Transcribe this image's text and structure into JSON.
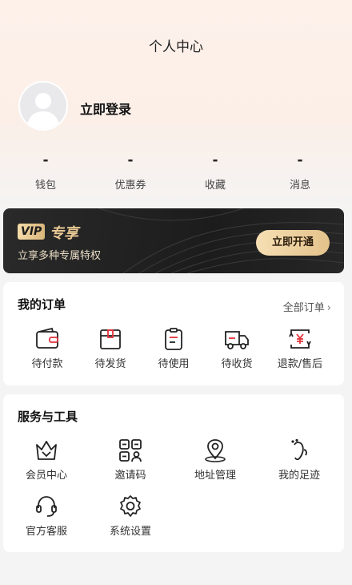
{
  "header": {
    "title": "个人中心"
  },
  "profile": {
    "login_label": "立即登录"
  },
  "stats": [
    {
      "value": "-",
      "label": "钱包"
    },
    {
      "value": "-",
      "label": "优惠券"
    },
    {
      "value": "-",
      "label": "收藏"
    },
    {
      "value": "-",
      "label": "消息"
    }
  ],
  "vip": {
    "badge": "VIP",
    "title": "专享",
    "subtitle": "立享多种专属特权",
    "button": "立即开通"
  },
  "orders": {
    "title": "我的订单",
    "all_label": "全部订单",
    "items": [
      {
        "label": "待付款",
        "icon": "wallet-icon"
      },
      {
        "label": "待发货",
        "icon": "package-icon"
      },
      {
        "label": "待使用",
        "icon": "clipboard-icon"
      },
      {
        "label": "待收货",
        "icon": "truck-icon"
      },
      {
        "label": "退款/售后",
        "icon": "refund-icon"
      }
    ]
  },
  "services": {
    "title": "服务与工具",
    "items": [
      {
        "label": "会员中心",
        "icon": "crown-icon"
      },
      {
        "label": "邀请码",
        "icon": "invite-code-icon"
      },
      {
        "label": "地址管理",
        "icon": "location-pin-icon"
      },
      {
        "label": "我的足迹",
        "icon": "footprint-icon"
      },
      {
        "label": "官方客服",
        "icon": "headset-icon"
      },
      {
        "label": "系统设置",
        "icon": "gear-icon"
      }
    ]
  },
  "colors": {
    "accent": "#e3333b",
    "vip_gold": "#e9c994",
    "vip_bg": "#1f1f1f"
  }
}
